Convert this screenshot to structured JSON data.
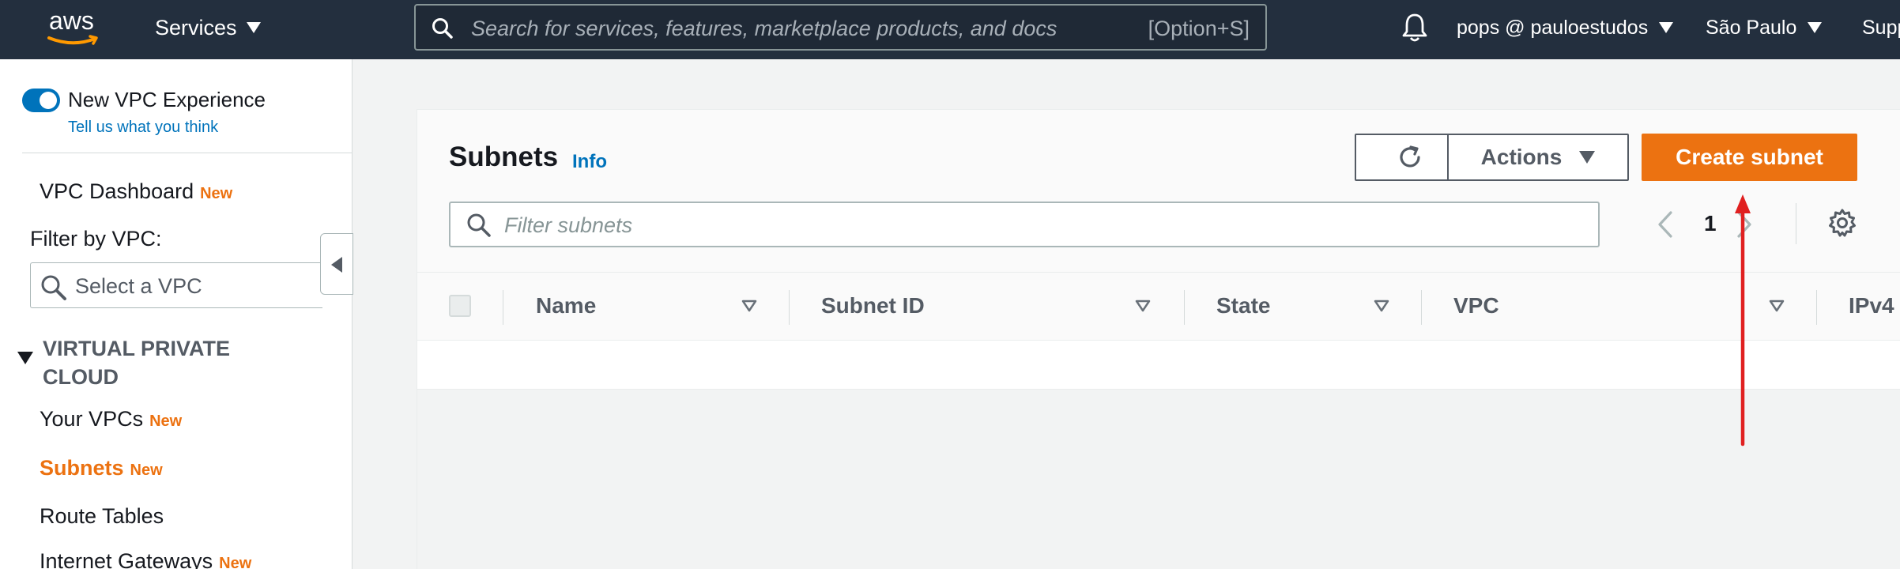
{
  "topbar": {
    "logo_text": "aws",
    "services_label": "Services",
    "search_placeholder": "Search for services, features, marketplace products, and docs",
    "search_shortcut": "[Option+S]",
    "user_label": "pops @ pauloestudos",
    "region_label": "São Paulo",
    "support_label": "Supp"
  },
  "sidebar": {
    "new_vpc_label": "New VPC Experience",
    "feedback_link": "Tell us what you think",
    "dashboard": {
      "label": "VPC Dashboard",
      "badge": "New"
    },
    "filter_label": "Filter by VPC:",
    "select_placeholder": "Select a VPC",
    "section_title": "VIRTUAL PRIVATE CLOUD",
    "items": [
      {
        "label": "Your VPCs",
        "badge": "New"
      },
      {
        "label": "Subnets",
        "badge": "New"
      },
      {
        "label": "Route Tables",
        "badge": ""
      },
      {
        "label": "Internet Gateways",
        "badge": "New"
      }
    ]
  },
  "main": {
    "title": "Subnets",
    "info_link": "Info",
    "actions_label": "Actions",
    "create_label": "Create subnet",
    "filter_placeholder": "Filter subnets",
    "page_number": "1",
    "columns": [
      "Name",
      "Subnet ID",
      "State",
      "VPC",
      "IPv4"
    ]
  },
  "colors": {
    "nav_bg": "#232f3e",
    "accent_orange": "#ec7211",
    "link_blue": "#0073bb",
    "annotation_red": "#e02020"
  },
  "icons": {
    "search": "search-icon",
    "bell": "bell-icon",
    "refresh": "refresh-icon",
    "gear": "gear-icon",
    "collapse": "chevron-left-icon"
  }
}
